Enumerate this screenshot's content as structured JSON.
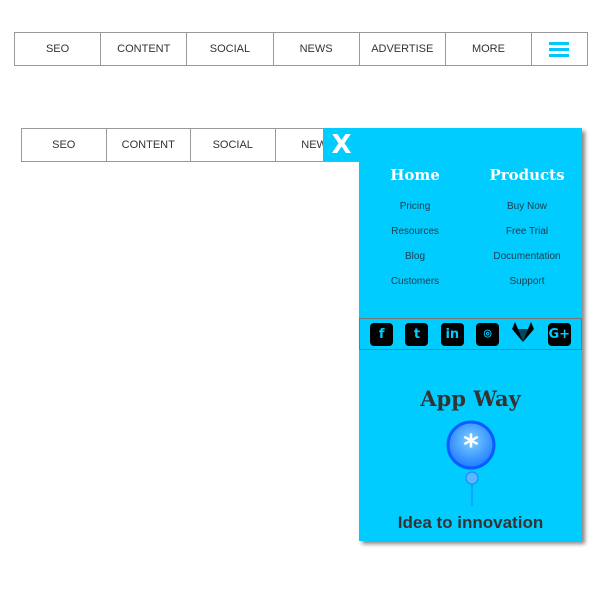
{
  "top_nav": {
    "items": [
      "SEO",
      "CONTENT",
      "SOCIAL",
      "NEWS",
      "ADVERTISE",
      "MORE"
    ],
    "menu_icon": "hamburger-icon",
    "accent": "#00c8ff"
  },
  "second_nav": {
    "items": [
      "SEO",
      "CONTENT",
      "SOCIAL",
      "NEWS"
    ]
  },
  "panel": {
    "close_label": "X",
    "background": "#00ccff",
    "columns": [
      {
        "title": "Home",
        "links": [
          "Pricing",
          "Resources",
          "Blog",
          "Customers"
        ]
      },
      {
        "title": "Products",
        "links": [
          "Buy Now",
          "Free Trial",
          "Documentation",
          "Support"
        ]
      }
    ],
    "social_icons": [
      "facebook-icon",
      "twitter-icon",
      "linkedin-icon",
      "github-icon",
      "gitlab-icon",
      "google-plus-icon"
    ],
    "social_glyphs": [
      "f",
      "t",
      "in",
      "⌾",
      "",
      "G+"
    ],
    "brand": "App Way",
    "tagline": "Idea to innovation"
  }
}
